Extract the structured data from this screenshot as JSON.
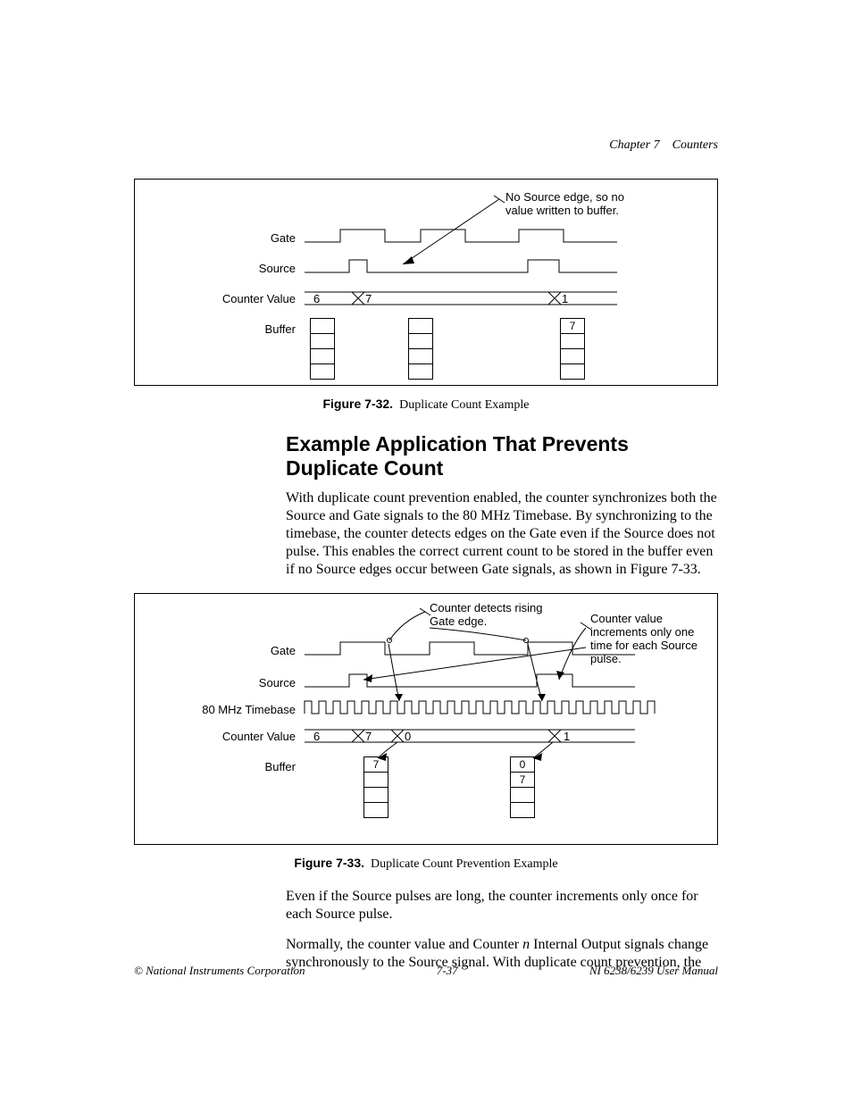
{
  "header": {
    "chapter": "Chapter 7",
    "title": "Counters"
  },
  "figure32": {
    "labels": {
      "gate": "Gate",
      "source": "Source",
      "counter_value": "Counter Value",
      "buffer": "Buffer"
    },
    "annotation": "No Source edge, so no value written to buffer.",
    "counter_values": [
      "6",
      "7",
      "1"
    ],
    "buffer_right_top": "7",
    "caption_num": "Figure 7-32.",
    "caption_text": "Duplicate Count Example"
  },
  "section_heading": "Example Application That Prevents Duplicate Count",
  "para1": "With duplicate count prevention enabled, the counter synchronizes both the Source and Gate signals to the 80 MHz Timebase. By synchronizing to the timebase, the counter detects edges on the Gate even if the Source does not pulse. This enables the correct current count to be stored in the buffer even if no Source edges occur between Gate signals, as shown in Figure 7-33.",
  "figure33": {
    "labels": {
      "gate": "Gate",
      "source": "Source",
      "timebase": "80 MHz Timebase",
      "counter_value": "Counter Value",
      "buffer": "Buffer"
    },
    "annot_left": "Counter detects rising Gate edge.",
    "annot_right": "Counter value increments only one time for each Source pulse.",
    "counter_values": [
      "6",
      "7",
      "0",
      "1"
    ],
    "buffer_left_top": "7",
    "buffer_right_vals": [
      "0",
      "7"
    ],
    "caption_num": "Figure 7-33.",
    "caption_text": "Duplicate Count Prevention Example"
  },
  "para2": "Even if the Source pulses are long, the counter increments only once for each Source pulse.",
  "para3_before_n": "Normally, the counter value and Counter ",
  "para3_n": "n",
  "para3_after_n": " Internal Output signals change synchronously to the Source signal. With duplicate count prevention, the",
  "footer": {
    "left": "© National Instruments Corporation",
    "center": "7-37",
    "right": "NI 6238/6239 User Manual"
  },
  "chart_data": [
    {
      "type": "table",
      "title": "Figure 7-32 timing diagram (Duplicate Count Example)",
      "signals": [
        "Gate",
        "Source",
        "Counter Value",
        "Buffer"
      ],
      "counter_value_sequence": [
        6,
        7,
        1
      ],
      "buffer_columns": [
        {
          "position": "after first gate",
          "values": []
        },
        {
          "position": "after second gate",
          "values": []
        },
        {
          "position": "after third gate",
          "values": [
            7
          ]
        }
      ],
      "annotation": "No Source edge, so no value written to buffer."
    },
    {
      "type": "table",
      "title": "Figure 7-33 timing diagram (Duplicate Count Prevention Example)",
      "signals": [
        "Gate",
        "Source",
        "80 MHz Timebase",
        "Counter Value",
        "Buffer"
      ],
      "counter_value_sequence": [
        6,
        7,
        0,
        1
      ],
      "buffer_columns": [
        {
          "position": "after first gate",
          "values": [
            7
          ]
        },
        {
          "position": "after second gate",
          "values": [
            0,
            7
          ]
        }
      ],
      "annotations": [
        "Counter detects rising Gate edge.",
        "Counter value increments only one time for each Source pulse."
      ]
    }
  ]
}
